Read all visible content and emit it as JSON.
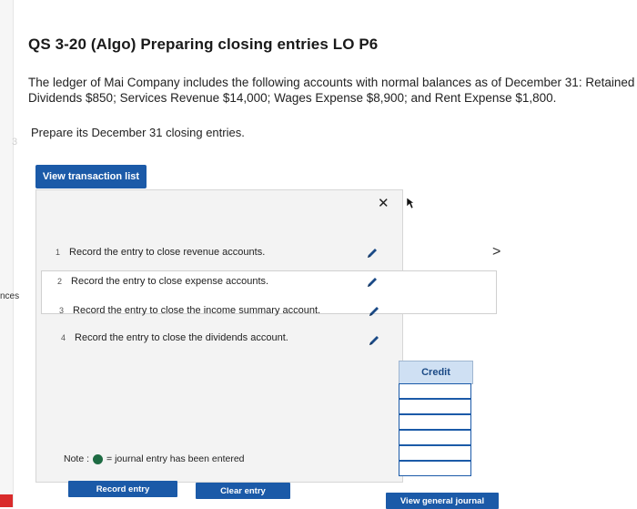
{
  "sidebar": {
    "partial_text": "nces"
  },
  "question": {
    "title": "QS 3-20 (Algo) Preparing closing entries LO P6",
    "line1": "The ledger of Mai Company includes the following accounts with normal balances as of December 31: Retained E",
    "line2": "Dividends $850; Services Revenue $14,000; Wages Expense $8,900; and Rent Expense $1,800.",
    "instruction": "Prepare its December 31 closing entries."
  },
  "buttons": {
    "view_transaction_list": "View transaction list",
    "record_entry": "Record entry",
    "clear_entry": "Clear entry",
    "view_general_journal": "View general journal"
  },
  "entries": [
    {
      "num": "1",
      "label": "Record the entry to close revenue accounts."
    },
    {
      "num": "2",
      "label": "Record the entry to close expense accounts."
    },
    {
      "num": "3",
      "label": "Record the entry to close the income summary account."
    },
    {
      "num": "4",
      "label": "Record the entry to close the dividends account."
    }
  ],
  "journal": {
    "credit_header": "Credit"
  },
  "note": {
    "prefix": "Note :",
    "text": "= journal entry has been entered"
  },
  "icons": {
    "close": "close-icon",
    "next": "chevron-right-icon",
    "edit": "pencil-icon",
    "complete": "green-dot-icon"
  },
  "colors": {
    "accent": "#1b5aa8",
    "credit_header_bg": "#cfe0f3",
    "complete_dot": "#1e6b43"
  }
}
